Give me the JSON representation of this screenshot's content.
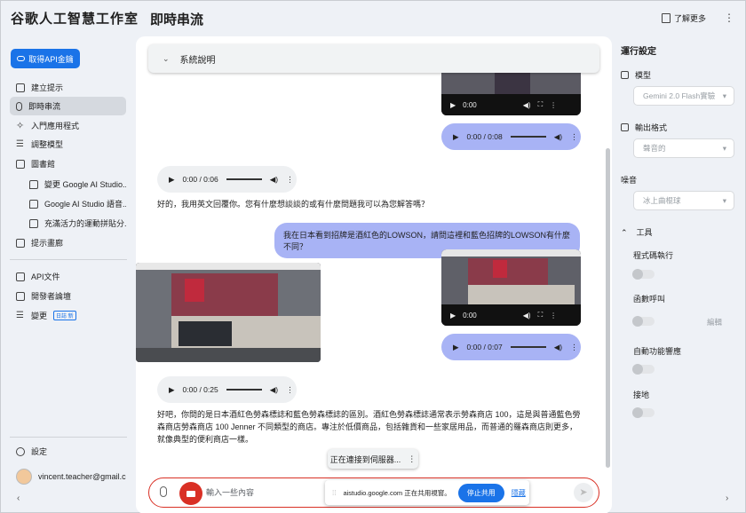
{
  "header": {
    "app_title": "谷歌人工智慧工作室",
    "page_title": "即時串流",
    "learn_more": "了解更多"
  },
  "sidebar": {
    "api_button": "取得API金鑰",
    "items": [
      {
        "label": "建立提示",
        "icon": "create-prompt-icon"
      },
      {
        "label": "即時串流",
        "icon": "mic-icon",
        "active": true
      },
      {
        "label": "入門應用程式",
        "icon": "starter-apps-icon"
      },
      {
        "label": "調整模型",
        "icon": "tune-icon"
      },
      {
        "label": "圖書館",
        "icon": "library-icon"
      }
    ],
    "library_items": [
      "變更 Google AI Studio...",
      "Google AI Studio 語音...",
      "充滿活力的運動拼貼分..."
    ],
    "prompt_gallery": "提示畫廊",
    "api_docs": "API文件",
    "forum": "開發者論壇",
    "changelog": "變更",
    "changelog_tag": "日誌 新",
    "settings": "設定",
    "user_email": "vincent.teacher@gmail.c..."
  },
  "main": {
    "system_instructions": "系統說明",
    "video_1_time": "0:00",
    "audio_user_1": "0:00 / 0:08",
    "audio_model_1": "0:00 / 0:06",
    "model_msg_1": "好的，我用英文回覆你。您有什麼想談談的或有什麼問題我可以為您解答嗎？",
    "user_msg_1": "我在日本看到招牌是酒紅色的LOWSON，請問這裡和藍色招牌的LOWSON有什麼不同？",
    "video_2_time": "0:00",
    "audio_user_2": "0:00 / 0:07",
    "audio_model_2": "0:00 / 0:25",
    "model_msg_2": "好吧，你問的是日本酒紅色勞森標誌和藍色勞森標誌的區別。酒紅色勞森標誌通常表示勞森商店 100，這是與普通藍色勞森商店勞森商店 100 Jenner 不同類型的商店。專注於低價商品，包括雜貨和一些家居用品，而普通的羅森商店則更多，就像典型的便利商店一樣。",
    "connecting": "正在連接到伺服器...",
    "input_placeholder": "輸入一些內容",
    "share_text": "aistudio.google.com 正在共用視窗。",
    "stop_share": "停止共用",
    "hide": "隱藏"
  },
  "run_settings": {
    "title": "運行設定",
    "model_label": "模型",
    "model_value": "Gemini 2.0 Flash實驗",
    "output_label": "輸出格式",
    "output_value": "聲音的",
    "voice_label": "噪音",
    "voice_value": "冰上曲棍球",
    "tools_label": "工具",
    "code_exec": "程式碼執行",
    "function_call": "函數呼叫",
    "edit": "編輯",
    "auto_tools": "自動功能響應",
    "grounding": "接地"
  },
  "colors": {
    "accent": "#1a73e8",
    "user_bubble": "#a8b3f5",
    "record": "#d93025",
    "active_nav": "#d5d9df"
  }
}
